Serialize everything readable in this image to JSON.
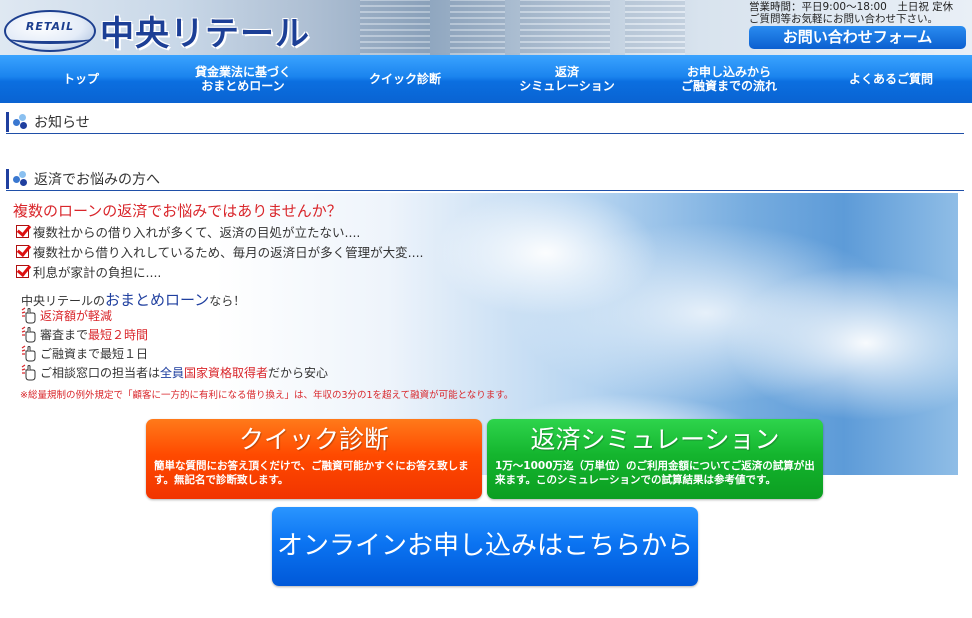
{
  "header": {
    "logo_badge": "RETAIL",
    "logo_name": "中央リテール",
    "hours_line1": "営業時間：平日9:00～18:00　土日祝 定休",
    "hours_line2": "ご質問等お気軽にお問い合わせ下さい。",
    "contact_button": "お問い合わせフォーム"
  },
  "nav": {
    "items": [
      {
        "label": "トップ"
      },
      {
        "label": "貸金業法に基づく\nおまとめローン"
      },
      {
        "label": "クイック診断"
      },
      {
        "label": "返済\nシミュレーション"
      },
      {
        "label": "お申し込みから\nご融資までの流れ"
      },
      {
        "label": "よくあるご質問"
      }
    ]
  },
  "sections": {
    "news_title": "お知らせ",
    "trouble_title": "返済でお悩みの方へ"
  },
  "hero": {
    "question": "複数のローンの返済でお悩みではありませんか？",
    "checks": [
      "複数社からの借り入れが多くて、返済の目処が立たない....",
      "複数社から借り入れしているため、毎月の返済日が多く管理が大変....",
      "利息が家計の負担に...."
    ],
    "intro_prefix": "中央リテールの",
    "intro_highlight": "おまとめローン",
    "intro_suffix": "なら！",
    "point1": "返済額が軽減",
    "point2_prefix": "審査まで",
    "point2_highlight": "最短２時間",
    "point3": "ご融資まで最短１日",
    "point4_prefix": "ご相談窓口の担当者は",
    "point4_blue": "全員",
    "point4_red": "国家資格取得者",
    "point4_suffix": "だから安心",
    "note": "※総量規制の例外規定で「顧客に一方的に有利になる借り換え」は、年収の3分の1を超えて融資が可能となります。"
  },
  "buttons": {
    "quick_title": "クイック診断",
    "quick_desc": "簡単な質問にお答え頂くだけで、ご融資可能かすぐにお答え致します。無記名で診断致します。",
    "sim_title": "返済シミュレーション",
    "sim_desc": "1万～1000万迄（万単位）のご利用金額についてご返済の試算が出来ます。このシミュレーションでの試算結果は参考値です。",
    "online_label": "オンラインお申し込みはこちらから"
  },
  "colors": {
    "accent_red": "#d9262b",
    "nav_blue": "#0b6fe0",
    "quick_orange": "#ff4a00",
    "sim_green": "#14b52e",
    "online_blue": "#0b74f2"
  },
  "icons": [
    "retail-logo-icon",
    "blue-dots-icon",
    "red-check-icon",
    "pointing-hand-icon"
  ]
}
